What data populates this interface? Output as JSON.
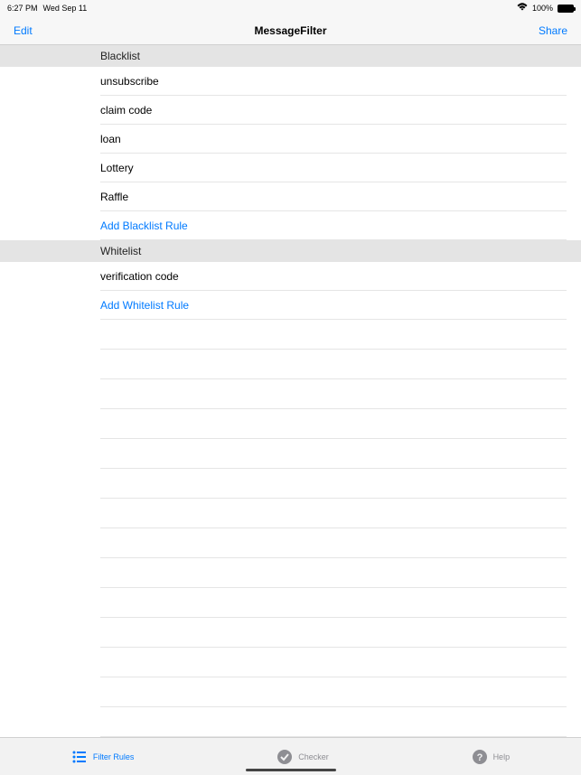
{
  "status": {
    "time": "6:27 PM",
    "date": "Wed Sep 11",
    "battery": "100%"
  },
  "nav": {
    "left": "Edit",
    "title": "MessageFilter",
    "right": "Share"
  },
  "sections": {
    "blacklist": {
      "header": "Blacklist",
      "items": [
        "unsubscribe",
        "claim code",
        "loan",
        "Lottery",
        "Raffle"
      ],
      "action": "Add Blacklist Rule"
    },
    "whitelist": {
      "header": "Whitelist",
      "items": [
        "verification code"
      ],
      "action": "Add Whitelist Rule"
    }
  },
  "tabs": {
    "filter": "Filter Rules",
    "checker": "Checker",
    "help": "Help"
  }
}
